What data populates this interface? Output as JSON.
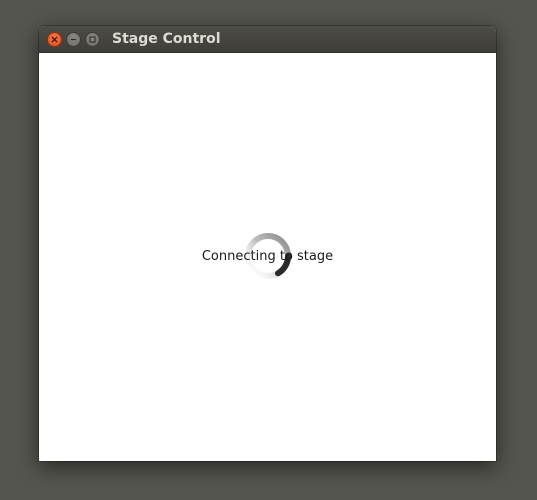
{
  "window": {
    "title": "Stage Control"
  },
  "window_controls": {
    "close_icon": "close-icon",
    "minimize_icon": "minimize-icon",
    "maximize_icon": "maximize-icon"
  },
  "content": {
    "status_text": "Connecting to stage",
    "spinner_icon": "loading-spinner-icon"
  },
  "colors": {
    "close_button": "#df4a16",
    "titlebar": "#45443f",
    "background": "#ffffff"
  }
}
